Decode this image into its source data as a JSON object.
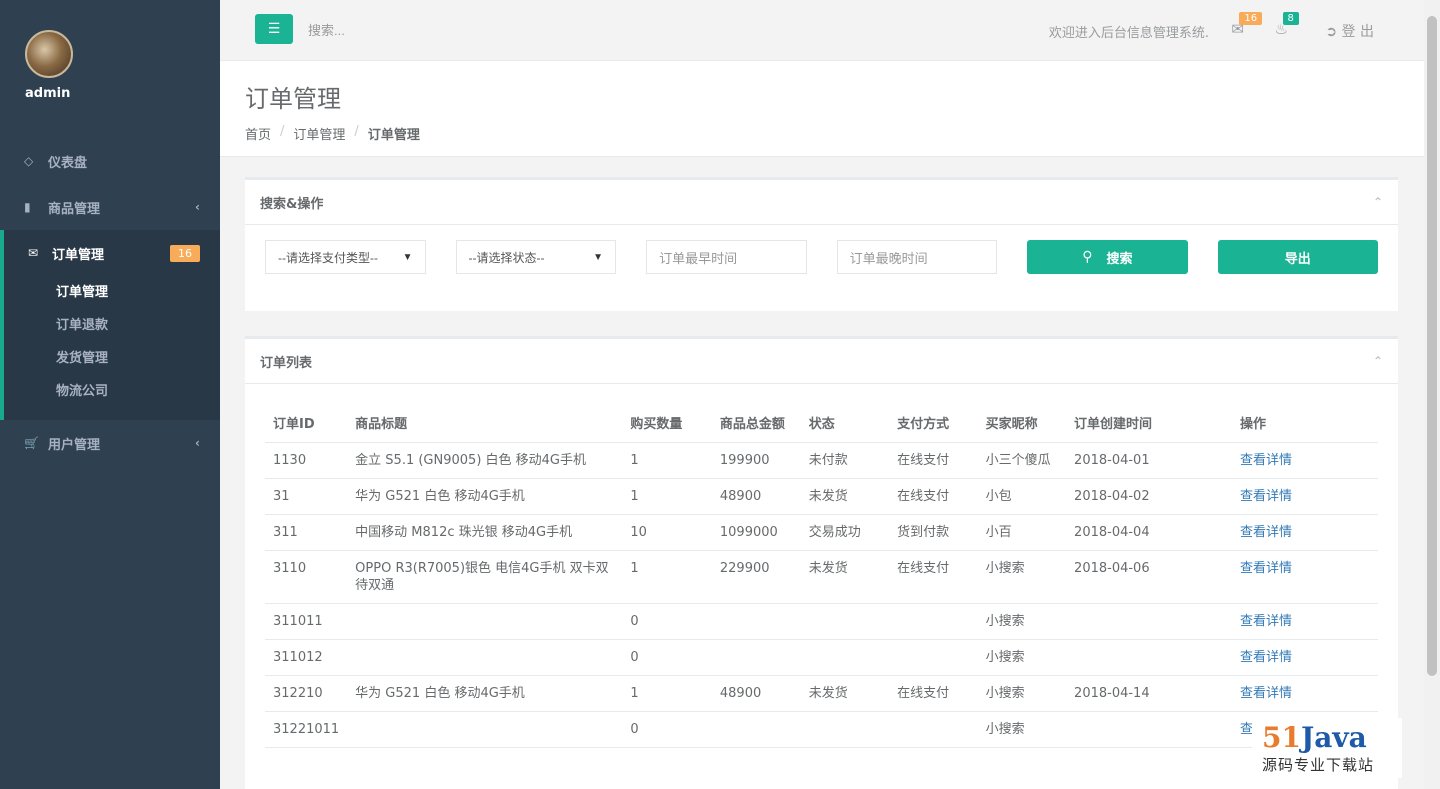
{
  "sidebar": {
    "username": "admin",
    "items": [
      {
        "label": "仪表盘",
        "icon": "diamond-icon"
      },
      {
        "label": "商品管理",
        "icon": "bar-chart-icon"
      },
      {
        "label": "订单管理",
        "icon": "envelope-icon",
        "badge": "16"
      },
      {
        "label": "用户管理",
        "icon": "cart-icon"
      }
    ],
    "order_sub": [
      "订单管理",
      "订单退款",
      "发货管理",
      "物流公司"
    ]
  },
  "topbar": {
    "search_placeholder": "搜索...",
    "welcome": "欢迎进入后台信息管理系统.",
    "mail_count": "16",
    "notify_count": "8",
    "logout": "登 出"
  },
  "heading": {
    "title": "订单管理",
    "breadcrumb": [
      "首页",
      "订单管理",
      "订单管理"
    ]
  },
  "filter_panel": {
    "title": "搜索&操作",
    "pay_type_select": "--请选择支付类型--",
    "status_select": "--请选择状态--",
    "start_time_placeholder": "订单最早时间",
    "end_time_placeholder": "订单最晚时间",
    "search_button": "搜索",
    "export_button": "导出"
  },
  "order_panel": {
    "title": "订单列表",
    "columns": [
      "订单ID",
      "商品标题",
      "购买数量",
      "商品总金额",
      "状态",
      "支付方式",
      "买家昵称",
      "订单创建时间",
      "操作"
    ],
    "rows": [
      [
        "1130",
        "金立 S5.1 (GN9005) 白色 移动4G手机",
        "1",
        "199900",
        "未付款",
        "在线支付",
        "小三个傻瓜",
        "2018-04-01",
        "查看详情"
      ],
      [
        "31",
        "华为 G521 白色 移动4G手机",
        "1",
        "48900",
        "未发货",
        "在线支付",
        "小包",
        "2018-04-02",
        "查看详情"
      ],
      [
        "311",
        "中国移动 M812c 珠光银 移动4G手机",
        "10",
        "1099000",
        "交易成功",
        "货到付款",
        "小百",
        "2018-04-04",
        "查看详情"
      ],
      [
        "3110",
        "OPPO R3(R7005)银色 电信4G手机 双卡双待双通",
        "1",
        "229900",
        "未发货",
        "在线支付",
        "小搜索",
        "2018-04-06",
        "查看详情"
      ],
      [
        "311011",
        "",
        "0",
        "",
        "",
        "",
        "小搜索",
        "",
        "查看详情"
      ],
      [
        "311012",
        "",
        "0",
        "",
        "",
        "",
        "小搜索",
        "",
        "查看详情"
      ],
      [
        "312210",
        "华为 G521 白色 移动4G手机",
        "1",
        "48900",
        "未发货",
        "在线支付",
        "小搜索",
        "2018-04-14",
        "查看详情"
      ],
      [
        "31221011",
        "",
        "0",
        "",
        "",
        "",
        "小搜索",
        "",
        "查看详情"
      ]
    ]
  },
  "watermark": {
    "brand_num": "51",
    "brand_name": "Java",
    "tagline": "源码专业下载站"
  },
  "colors": {
    "sidebar": "#2f4050",
    "accent": "#1ab394",
    "warning": "#f8ac59",
    "link": "#337ab7"
  }
}
